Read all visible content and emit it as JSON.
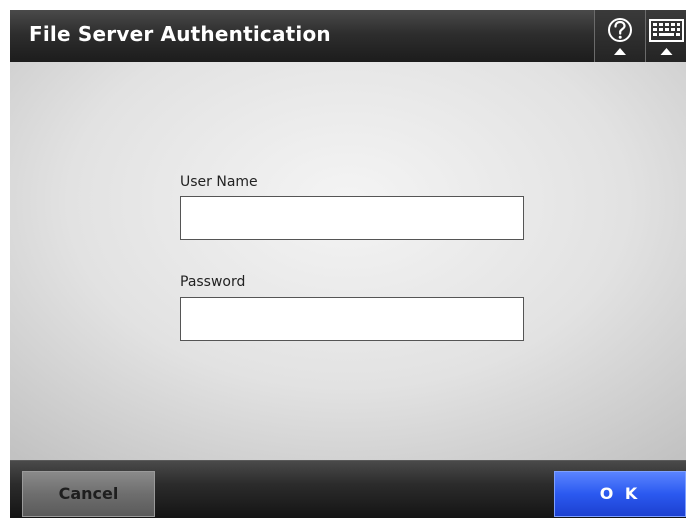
{
  "header": {
    "title": "File Server Authentication",
    "help_icon": "help-icon",
    "keyboard_icon": "keyboard-icon"
  },
  "form": {
    "username": {
      "label": "User Name",
      "value": "",
      "placeholder": ""
    },
    "password": {
      "label": "Password",
      "value": "",
      "placeholder": ""
    }
  },
  "footer": {
    "cancel_label": "Cancel",
    "ok_label": "O K"
  },
  "colors": {
    "header_bg": "#2e2e2e",
    "panel_bg": "#e2e2e2",
    "ok_button": "#2b59f0",
    "cancel_button": "#6e6e6e"
  }
}
